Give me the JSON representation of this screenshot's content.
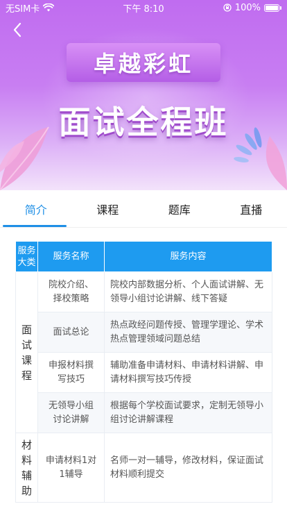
{
  "status_bar": {
    "carrier": "无SIM卡",
    "time": "下午 8:10",
    "battery": "100%"
  },
  "hero": {
    "banner_text": "卓越彩虹",
    "title": "面试全程班"
  },
  "tabs": [
    {
      "label": "简介",
      "active": true
    },
    {
      "label": "课程",
      "active": false
    },
    {
      "label": "题库",
      "active": false
    },
    {
      "label": "直播",
      "active": false
    }
  ],
  "table": {
    "headers": [
      "服务大类",
      "服务名称",
      "服务内容"
    ],
    "groups": [
      {
        "category": "面试课程",
        "rows": [
          {
            "name": "院校介绍、择校策略",
            "content": "院校内部数据分析、个人面试讲解、无领导小组讨论讲解、线下答疑"
          },
          {
            "name": "面试总论",
            "content": "热点政经问题传授、管理学理论、学术热点管理领域问题总结"
          },
          {
            "name": "申报材料撰写技巧",
            "content": "辅助准备申请材料、申请材料讲解、申请材料撰写技巧传授"
          },
          {
            "name": "无领导小组讨论讲解",
            "content": "根据每个学校面试要求，定制无领导小组讨论讲解课程"
          }
        ]
      },
      {
        "category": "材料辅助",
        "rows": [
          {
            "name": "申请材料1对1辅导",
            "content": "名师一对一辅导，修改材料，保证面试材料顺利提交"
          }
        ]
      }
    ]
  },
  "colors": {
    "accent": "#1e8fe6",
    "table_header": "#1e9bf0",
    "hero_purple": "#c06cf0"
  }
}
